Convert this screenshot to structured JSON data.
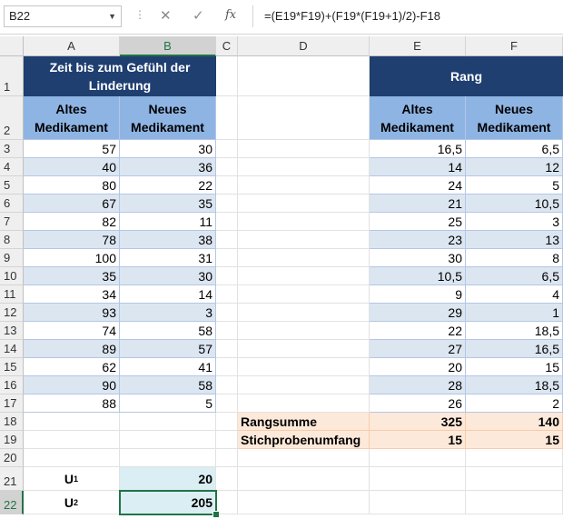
{
  "formula_bar": {
    "name_box": "B22",
    "fx": "fx",
    "formula": "=(E19*F19)+(F19*(F19+1)/2)-F18"
  },
  "columns": [
    "A",
    "B",
    "C",
    "D",
    "E",
    "F"
  ],
  "rows": [
    "1",
    "2",
    "3",
    "4",
    "5",
    "6",
    "7",
    "8",
    "9",
    "10",
    "11",
    "12",
    "13",
    "14",
    "15",
    "16",
    "17",
    "18",
    "19",
    "20",
    "21",
    "22"
  ],
  "selected": {
    "col": "B",
    "row": "22"
  },
  "left_table": {
    "title": "Zeit bis zum Gefühl der Linderung",
    "headers": [
      "Altes Medikament",
      "Neues Medikament"
    ],
    "rows": [
      [
        "57",
        "30"
      ],
      [
        "40",
        "36"
      ],
      [
        "80",
        "22"
      ],
      [
        "67",
        "35"
      ],
      [
        "82",
        "11"
      ],
      [
        "78",
        "38"
      ],
      [
        "100",
        "31"
      ],
      [
        "35",
        "30"
      ],
      [
        "34",
        "14"
      ],
      [
        "93",
        "3"
      ],
      [
        "74",
        "58"
      ],
      [
        "89",
        "57"
      ],
      [
        "62",
        "41"
      ],
      [
        "90",
        "58"
      ],
      [
        "88",
        "5"
      ]
    ]
  },
  "right_table": {
    "title": "Rang",
    "headers": [
      "Altes Medikament",
      "Neues Medikament"
    ],
    "rows": [
      [
        "16,5",
        "6,5"
      ],
      [
        "14",
        "12"
      ],
      [
        "24",
        "5"
      ],
      [
        "21",
        "10,5"
      ],
      [
        "25",
        "3"
      ],
      [
        "23",
        "13"
      ],
      [
        "30",
        "8"
      ],
      [
        "10,5",
        "6,5"
      ],
      [
        "9",
        "4"
      ],
      [
        "29",
        "1"
      ],
      [
        "22",
        "18,5"
      ],
      [
        "27",
        "16,5"
      ],
      [
        "20",
        "15"
      ],
      [
        "28",
        "18,5"
      ],
      [
        "26",
        "2"
      ]
    ]
  },
  "summary": [
    {
      "label": "Rangsumme",
      "e": "325",
      "f": "140"
    },
    {
      "label": "Stichprobenumfang",
      "e": "15",
      "f": "15"
    }
  ],
  "u_values": [
    {
      "letter": "U",
      "sub": "1",
      "value": "20"
    },
    {
      "letter": "U",
      "sub": "2",
      "value": "205"
    }
  ],
  "colors": {
    "dark_header": "#1f3f71",
    "light_header": "#8eb4e3",
    "stripe": "#dce6f1",
    "peach": "#fde9d9",
    "teal": "#daeef3",
    "selection": "#217346"
  }
}
